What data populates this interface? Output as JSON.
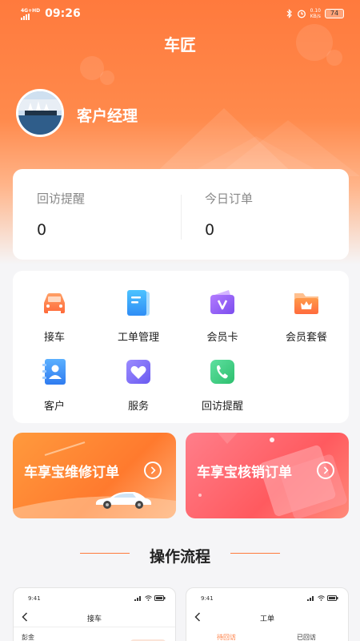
{
  "status_bar": {
    "network": "4G+HD",
    "time": "09:26",
    "net_speed_value": "0.10",
    "net_speed_unit": "KB/s",
    "battery": "74"
  },
  "app": {
    "title": "车匠"
  },
  "profile": {
    "role": "客户经理"
  },
  "stats": [
    {
      "label": "回访提醒",
      "value": "0"
    },
    {
      "label": "今日订单",
      "value": "0"
    }
  ],
  "menu": [
    {
      "label": "接车",
      "icon": "car-icon"
    },
    {
      "label": "工单管理",
      "icon": "document-icon"
    },
    {
      "label": "会员卡",
      "icon": "member-card-icon"
    },
    {
      "label": "会员套餐",
      "icon": "crown-folder-icon"
    },
    {
      "label": "客户",
      "icon": "customer-icon"
    },
    {
      "label": "服务",
      "icon": "heart-icon"
    },
    {
      "label": "回访提醒",
      "icon": "phone-icon"
    }
  ],
  "banners": [
    {
      "label": "车享宝维修订单"
    },
    {
      "label": "车享宝核销订单"
    }
  ],
  "section": {
    "title": "操作流程"
  },
  "previews": [
    {
      "time": "9:41",
      "title": "接车",
      "sub": "彭金"
    },
    {
      "time": "9:41",
      "title": "工单",
      "tab_active": "待回访",
      "tab_other": "已回访"
    }
  ],
  "colors": {
    "brand": "#ff7a3d",
    "banner_left": "#ff8a33",
    "banner_right": "#ff6464"
  }
}
